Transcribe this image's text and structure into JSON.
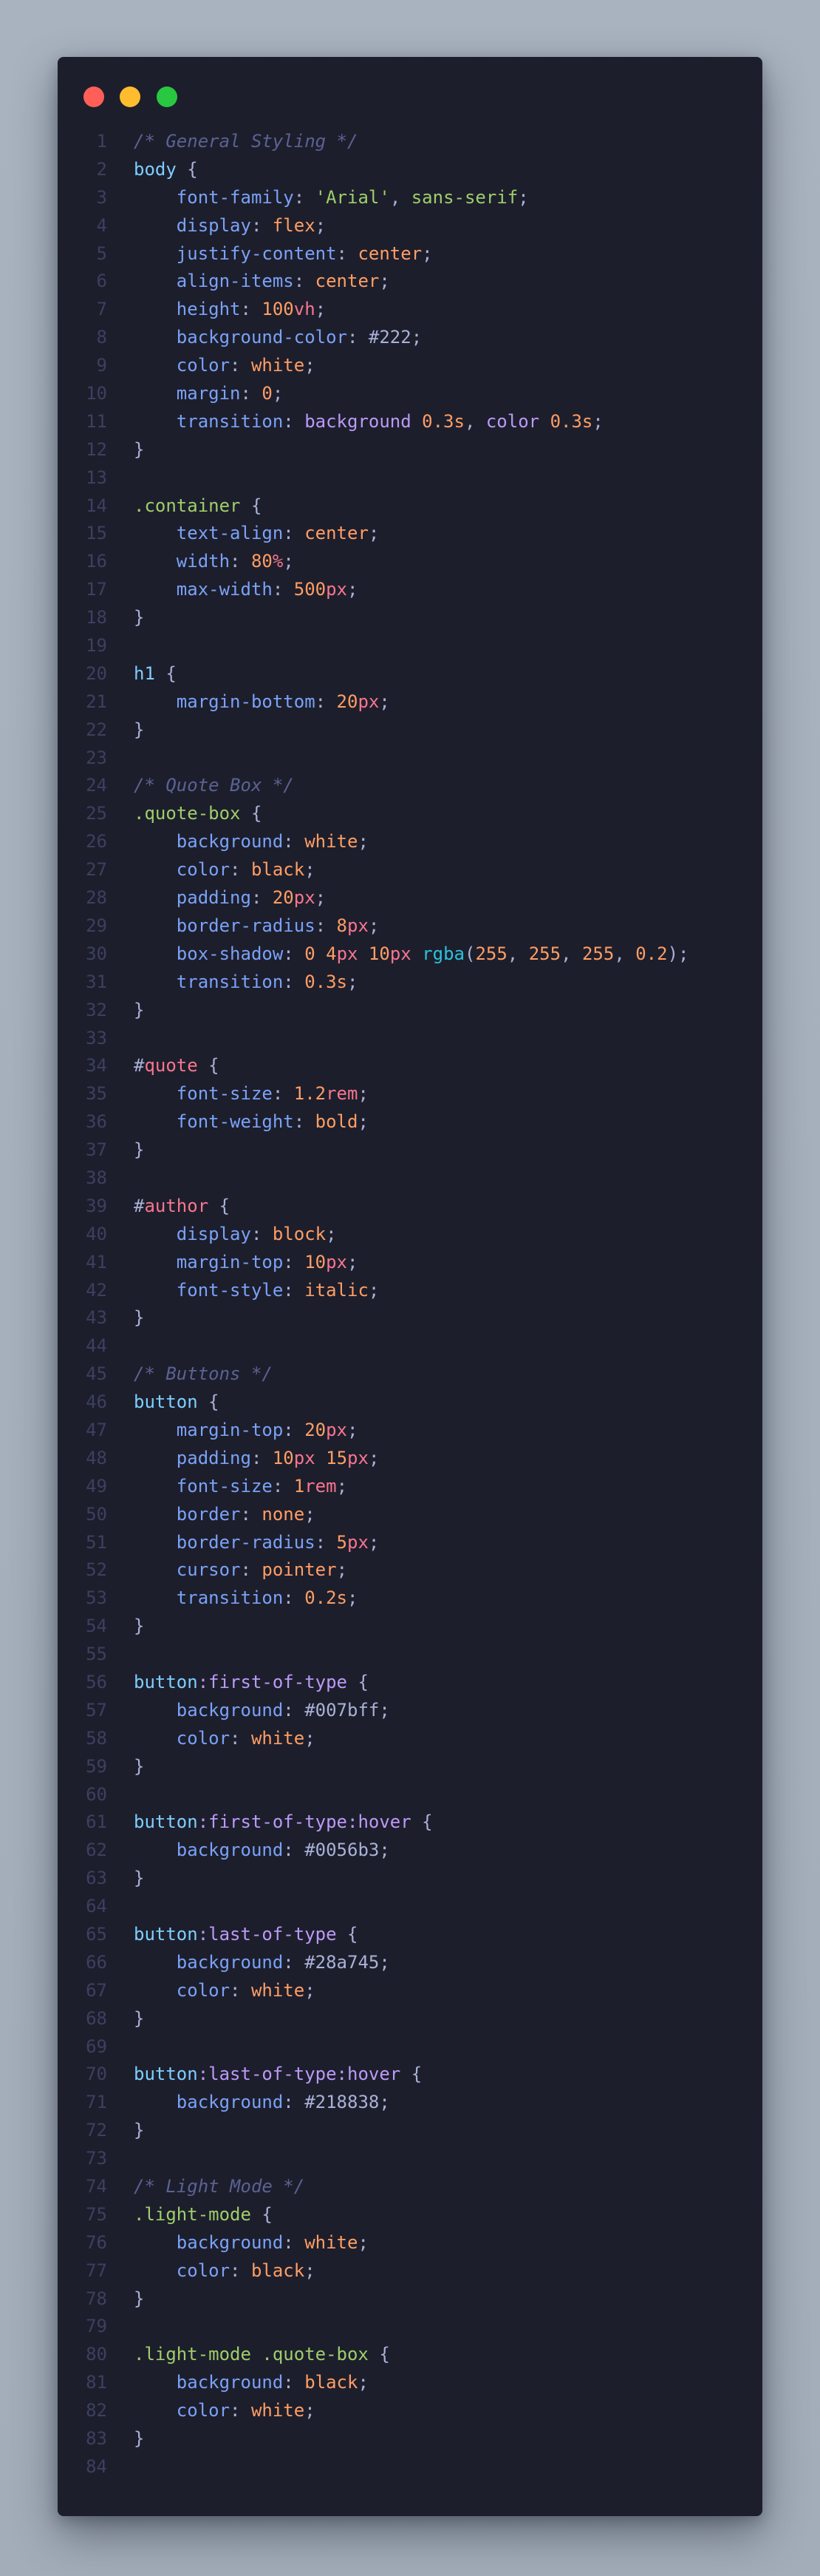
{
  "window": {
    "traffic_lights": [
      {
        "name": "close",
        "color": "#ff5f57"
      },
      {
        "name": "minimize",
        "color": "#febc2e"
      },
      {
        "name": "zoom",
        "color": "#28c840"
      }
    ]
  },
  "code": {
    "language": "css",
    "lines": [
      [
        [
          "c",
          "/* General Styling */"
        ]
      ],
      [
        [
          "sel",
          "body"
        ],
        [
          "br",
          " {"
        ]
      ],
      [
        [
          "pl",
          "    "
        ],
        [
          "p",
          "font-family"
        ],
        [
          "pl",
          ": "
        ],
        [
          "s",
          "'Arial'"
        ],
        [
          "pl",
          ", "
        ],
        [
          "s",
          "sans-serif"
        ],
        [
          "pl",
          ";"
        ]
      ],
      [
        [
          "pl",
          "    "
        ],
        [
          "p",
          "display"
        ],
        [
          "pl",
          ": "
        ],
        [
          "k",
          "flex"
        ],
        [
          "pl",
          ";"
        ]
      ],
      [
        [
          "pl",
          "    "
        ],
        [
          "p",
          "justify-content"
        ],
        [
          "pl",
          ": "
        ],
        [
          "k",
          "center"
        ],
        [
          "pl",
          ";"
        ]
      ],
      [
        [
          "pl",
          "    "
        ],
        [
          "p",
          "align-items"
        ],
        [
          "pl",
          ": "
        ],
        [
          "k",
          "center"
        ],
        [
          "pl",
          ";"
        ]
      ],
      [
        [
          "pl",
          "    "
        ],
        [
          "p",
          "height"
        ],
        [
          "pl",
          ": "
        ],
        [
          "n",
          "100"
        ],
        [
          "u",
          "vh"
        ],
        [
          "pl",
          ";"
        ]
      ],
      [
        [
          "pl",
          "    "
        ],
        [
          "p",
          "background-color"
        ],
        [
          "pl",
          ": "
        ],
        [
          "h",
          "#222"
        ],
        [
          "pl",
          ";"
        ]
      ],
      [
        [
          "pl",
          "    "
        ],
        [
          "p",
          "color"
        ],
        [
          "pl",
          ": "
        ],
        [
          "k",
          "white"
        ],
        [
          "pl",
          ";"
        ]
      ],
      [
        [
          "pl",
          "    "
        ],
        [
          "p",
          "margin"
        ],
        [
          "pl",
          ": "
        ],
        [
          "n",
          "0"
        ],
        [
          "pl",
          ";"
        ]
      ],
      [
        [
          "pl",
          "    "
        ],
        [
          "p",
          "transition"
        ],
        [
          "pl",
          ": "
        ],
        [
          "ps",
          "background"
        ],
        [
          "pl",
          " "
        ],
        [
          "n",
          "0.3s"
        ],
        [
          "pl",
          ", "
        ],
        [
          "ps",
          "color"
        ],
        [
          "pl",
          " "
        ],
        [
          "n",
          "0.3s"
        ],
        [
          "pl",
          ";"
        ]
      ],
      [
        [
          "br",
          "}"
        ]
      ],
      [],
      [
        [
          "cls",
          ".container"
        ],
        [
          "br",
          " {"
        ]
      ],
      [
        [
          "pl",
          "    "
        ],
        [
          "p",
          "text-align"
        ],
        [
          "pl",
          ": "
        ],
        [
          "k",
          "center"
        ],
        [
          "pl",
          ";"
        ]
      ],
      [
        [
          "pl",
          "    "
        ],
        [
          "p",
          "width"
        ],
        [
          "pl",
          ": "
        ],
        [
          "n",
          "80"
        ],
        [
          "u",
          "%"
        ],
        [
          "pl",
          ";"
        ]
      ],
      [
        [
          "pl",
          "    "
        ],
        [
          "p",
          "max-width"
        ],
        [
          "pl",
          ": "
        ],
        [
          "n",
          "500"
        ],
        [
          "u",
          "px"
        ],
        [
          "pl",
          ";"
        ]
      ],
      [
        [
          "br",
          "}"
        ]
      ],
      [],
      [
        [
          "sel",
          "h1"
        ],
        [
          "br",
          " {"
        ]
      ],
      [
        [
          "pl",
          "    "
        ],
        [
          "p",
          "margin-bottom"
        ],
        [
          "pl",
          ": "
        ],
        [
          "n",
          "20"
        ],
        [
          "u",
          "px"
        ],
        [
          "pl",
          ";"
        ]
      ],
      [
        [
          "br",
          "}"
        ]
      ],
      [],
      [
        [
          "c",
          "/* Quote Box */"
        ]
      ],
      [
        [
          "cls",
          ".quote-box"
        ],
        [
          "br",
          " {"
        ]
      ],
      [
        [
          "pl",
          "    "
        ],
        [
          "p",
          "background"
        ],
        [
          "pl",
          ": "
        ],
        [
          "k",
          "white"
        ],
        [
          "pl",
          ";"
        ]
      ],
      [
        [
          "pl",
          "    "
        ],
        [
          "p",
          "color"
        ],
        [
          "pl",
          ": "
        ],
        [
          "k",
          "black"
        ],
        [
          "pl",
          ";"
        ]
      ],
      [
        [
          "pl",
          "    "
        ],
        [
          "p",
          "padding"
        ],
        [
          "pl",
          ": "
        ],
        [
          "n",
          "20"
        ],
        [
          "u",
          "px"
        ],
        [
          "pl",
          ";"
        ]
      ],
      [
        [
          "pl",
          "    "
        ],
        [
          "p",
          "border-radius"
        ],
        [
          "pl",
          ": "
        ],
        [
          "n",
          "8"
        ],
        [
          "u",
          "px"
        ],
        [
          "pl",
          ";"
        ]
      ],
      [
        [
          "pl",
          "    "
        ],
        [
          "p",
          "box-shadow"
        ],
        [
          "pl",
          ": "
        ],
        [
          "n",
          "0"
        ],
        [
          "pl",
          " "
        ],
        [
          "n",
          "4"
        ],
        [
          "u",
          "px"
        ],
        [
          "pl",
          " "
        ],
        [
          "n",
          "10"
        ],
        [
          "u",
          "px"
        ],
        [
          "pl",
          " "
        ],
        [
          "f",
          "rgba"
        ],
        [
          "pl",
          "("
        ],
        [
          "n",
          "255"
        ],
        [
          "pl",
          ", "
        ],
        [
          "n",
          "255"
        ],
        [
          "pl",
          ", "
        ],
        [
          "n",
          "255"
        ],
        [
          "pl",
          ", "
        ],
        [
          "n",
          "0.2"
        ],
        [
          "pl",
          ");"
        ]
      ],
      [
        [
          "pl",
          "    "
        ],
        [
          "p",
          "transition"
        ],
        [
          "pl",
          ": "
        ],
        [
          "n",
          "0.3s"
        ],
        [
          "pl",
          ";"
        ]
      ],
      [
        [
          "br",
          "}"
        ]
      ],
      [],
      [
        [
          "br",
          "#"
        ],
        [
          "id",
          "quote"
        ],
        [
          "br",
          " {"
        ]
      ],
      [
        [
          "pl",
          "    "
        ],
        [
          "p",
          "font-size"
        ],
        [
          "pl",
          ": "
        ],
        [
          "n",
          "1.2"
        ],
        [
          "u",
          "rem"
        ],
        [
          "pl",
          ";"
        ]
      ],
      [
        [
          "pl",
          "    "
        ],
        [
          "p",
          "font-weight"
        ],
        [
          "pl",
          ": "
        ],
        [
          "k",
          "bold"
        ],
        [
          "pl",
          ";"
        ]
      ],
      [
        [
          "br",
          "}"
        ]
      ],
      [],
      [
        [
          "br",
          "#"
        ],
        [
          "id",
          "author"
        ],
        [
          "br",
          " {"
        ]
      ],
      [
        [
          "pl",
          "    "
        ],
        [
          "p",
          "display"
        ],
        [
          "pl",
          ": "
        ],
        [
          "k",
          "block"
        ],
        [
          "pl",
          ";"
        ]
      ],
      [
        [
          "pl",
          "    "
        ],
        [
          "p",
          "margin-top"
        ],
        [
          "pl",
          ": "
        ],
        [
          "n",
          "10"
        ],
        [
          "u",
          "px"
        ],
        [
          "pl",
          ";"
        ]
      ],
      [
        [
          "pl",
          "    "
        ],
        [
          "p",
          "font-style"
        ],
        [
          "pl",
          ": "
        ],
        [
          "k",
          "italic"
        ],
        [
          "pl",
          ";"
        ]
      ],
      [
        [
          "br",
          "}"
        ]
      ],
      [],
      [
        [
          "c",
          "/* Buttons */"
        ]
      ],
      [
        [
          "sel",
          "button"
        ],
        [
          "br",
          " {"
        ]
      ],
      [
        [
          "pl",
          "    "
        ],
        [
          "p",
          "margin-top"
        ],
        [
          "pl",
          ": "
        ],
        [
          "n",
          "20"
        ],
        [
          "u",
          "px"
        ],
        [
          "pl",
          ";"
        ]
      ],
      [
        [
          "pl",
          "    "
        ],
        [
          "p",
          "padding"
        ],
        [
          "pl",
          ": "
        ],
        [
          "n",
          "10"
        ],
        [
          "u",
          "px"
        ],
        [
          "pl",
          " "
        ],
        [
          "n",
          "15"
        ],
        [
          "u",
          "px"
        ],
        [
          "pl",
          ";"
        ]
      ],
      [
        [
          "pl",
          "    "
        ],
        [
          "p",
          "font-size"
        ],
        [
          "pl",
          ": "
        ],
        [
          "n",
          "1"
        ],
        [
          "u",
          "rem"
        ],
        [
          "pl",
          ";"
        ]
      ],
      [
        [
          "pl",
          "    "
        ],
        [
          "p",
          "border"
        ],
        [
          "pl",
          ": "
        ],
        [
          "k",
          "none"
        ],
        [
          "pl",
          ";"
        ]
      ],
      [
        [
          "pl",
          "    "
        ],
        [
          "p",
          "border-radius"
        ],
        [
          "pl",
          ": "
        ],
        [
          "n",
          "5"
        ],
        [
          "u",
          "px"
        ],
        [
          "pl",
          ";"
        ]
      ],
      [
        [
          "pl",
          "    "
        ],
        [
          "p",
          "cursor"
        ],
        [
          "pl",
          ": "
        ],
        [
          "k",
          "pointer"
        ],
        [
          "pl",
          ";"
        ]
      ],
      [
        [
          "pl",
          "    "
        ],
        [
          "p",
          "transition"
        ],
        [
          "pl",
          ": "
        ],
        [
          "n",
          "0.2s"
        ],
        [
          "pl",
          ";"
        ]
      ],
      [
        [
          "br",
          "}"
        ]
      ],
      [],
      [
        [
          "sel",
          "button"
        ],
        [
          "ps",
          ":first-of-type"
        ],
        [
          "br",
          " {"
        ]
      ],
      [
        [
          "pl",
          "    "
        ],
        [
          "p",
          "background"
        ],
        [
          "pl",
          ": "
        ],
        [
          "h",
          "#007bff"
        ],
        [
          "pl",
          ";"
        ]
      ],
      [
        [
          "pl",
          "    "
        ],
        [
          "p",
          "color"
        ],
        [
          "pl",
          ": "
        ],
        [
          "k",
          "white"
        ],
        [
          "pl",
          ";"
        ]
      ],
      [
        [
          "br",
          "}"
        ]
      ],
      [],
      [
        [
          "sel",
          "button"
        ],
        [
          "ps",
          ":first-of-type:hover"
        ],
        [
          "br",
          " {"
        ]
      ],
      [
        [
          "pl",
          "    "
        ],
        [
          "p",
          "background"
        ],
        [
          "pl",
          ": "
        ],
        [
          "h",
          "#0056b3"
        ],
        [
          "pl",
          ";"
        ]
      ],
      [
        [
          "br",
          "}"
        ]
      ],
      [],
      [
        [
          "sel",
          "button"
        ],
        [
          "ps",
          ":last-of-type"
        ],
        [
          "br",
          " {"
        ]
      ],
      [
        [
          "pl",
          "    "
        ],
        [
          "p",
          "background"
        ],
        [
          "pl",
          ": "
        ],
        [
          "h",
          "#28a745"
        ],
        [
          "pl",
          ";"
        ]
      ],
      [
        [
          "pl",
          "    "
        ],
        [
          "p",
          "color"
        ],
        [
          "pl",
          ": "
        ],
        [
          "k",
          "white"
        ],
        [
          "pl",
          ";"
        ]
      ],
      [
        [
          "br",
          "}"
        ]
      ],
      [],
      [
        [
          "sel",
          "button"
        ],
        [
          "ps",
          ":last-of-type:hover"
        ],
        [
          "br",
          " {"
        ]
      ],
      [
        [
          "pl",
          "    "
        ],
        [
          "p",
          "background"
        ],
        [
          "pl",
          ": "
        ],
        [
          "h",
          "#218838"
        ],
        [
          "pl",
          ";"
        ]
      ],
      [
        [
          "br",
          "}"
        ]
      ],
      [],
      [
        [
          "c",
          "/* Light Mode */"
        ]
      ],
      [
        [
          "cls",
          ".light-mode"
        ],
        [
          "br",
          " {"
        ]
      ],
      [
        [
          "pl",
          "    "
        ],
        [
          "p",
          "background"
        ],
        [
          "pl",
          ": "
        ],
        [
          "k",
          "white"
        ],
        [
          "pl",
          ";"
        ]
      ],
      [
        [
          "pl",
          "    "
        ],
        [
          "p",
          "color"
        ],
        [
          "pl",
          ": "
        ],
        [
          "k",
          "black"
        ],
        [
          "pl",
          ";"
        ]
      ],
      [
        [
          "br",
          "}"
        ]
      ],
      [],
      [
        [
          "cls",
          ".light-mode .quote-box"
        ],
        [
          "br",
          " {"
        ]
      ],
      [
        [
          "pl",
          "    "
        ],
        [
          "p",
          "background"
        ],
        [
          "pl",
          ": "
        ],
        [
          "k",
          "black"
        ],
        [
          "pl",
          ";"
        ]
      ],
      [
        [
          "pl",
          "    "
        ],
        [
          "p",
          "color"
        ],
        [
          "pl",
          ": "
        ],
        [
          "k",
          "white"
        ],
        [
          "pl",
          ";"
        ]
      ],
      [
        [
          "br",
          "}"
        ]
      ],
      []
    ]
  }
}
